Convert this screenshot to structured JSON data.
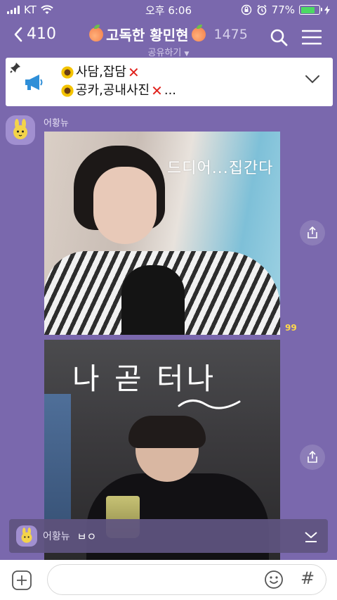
{
  "status": {
    "carrier": "KT",
    "time": "오후 6:06",
    "battery": "77%",
    "battery_level": 0.77
  },
  "header": {
    "back_count": "410",
    "title": "고독한 황민현",
    "member_count": "1475",
    "subtitle": "공유하기"
  },
  "notice": {
    "line1": "사담,잡담",
    "line2": "공카,공내사진",
    "line2_suffix": "..."
  },
  "message": {
    "sender": "어황뉴",
    "photo1_caption": "드디어...집간다",
    "photo2_caption": "나 곧 터나",
    "read_count": "99"
  },
  "preview": {
    "sender": "어황뉴",
    "text": "ㅂㅇ"
  },
  "input": {
    "placeholder": ""
  },
  "colors": {
    "background": "#7a68ad",
    "unread": "#ffd94a",
    "battery": "#4cd964",
    "x_mark": "#e0221c"
  }
}
